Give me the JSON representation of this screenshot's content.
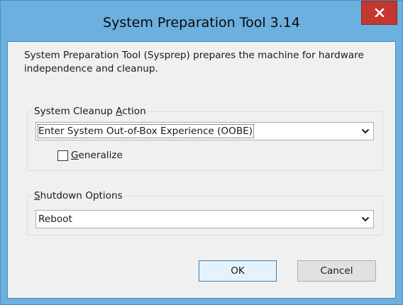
{
  "window": {
    "title": "System Preparation Tool 3.14",
    "close_glyph": "x",
    "close_color": "#c4372f",
    "frame_color": "#6bb0df"
  },
  "description": "System Preparation Tool (Sysprep) prepares the machine for hardware independence and cleanup.",
  "cleanup": {
    "group_label_prefix": "System Cleanup ",
    "group_label_mnemonic": "A",
    "group_label_suffix": "ction",
    "selected_action": "Enter System Out-of-Box Experience (OOBE)",
    "generalize": {
      "label_mnemonic": "G",
      "label_suffix": "eneralize",
      "checked": false
    }
  },
  "shutdown": {
    "group_label_mnemonic": "S",
    "group_label_suffix": "hutdown Options",
    "selected_option": "Reboot"
  },
  "buttons": {
    "ok_label": "OK",
    "cancel_label": "Cancel"
  },
  "icons": {
    "close": "close-icon",
    "dropdown": "chevron-down-icon"
  }
}
